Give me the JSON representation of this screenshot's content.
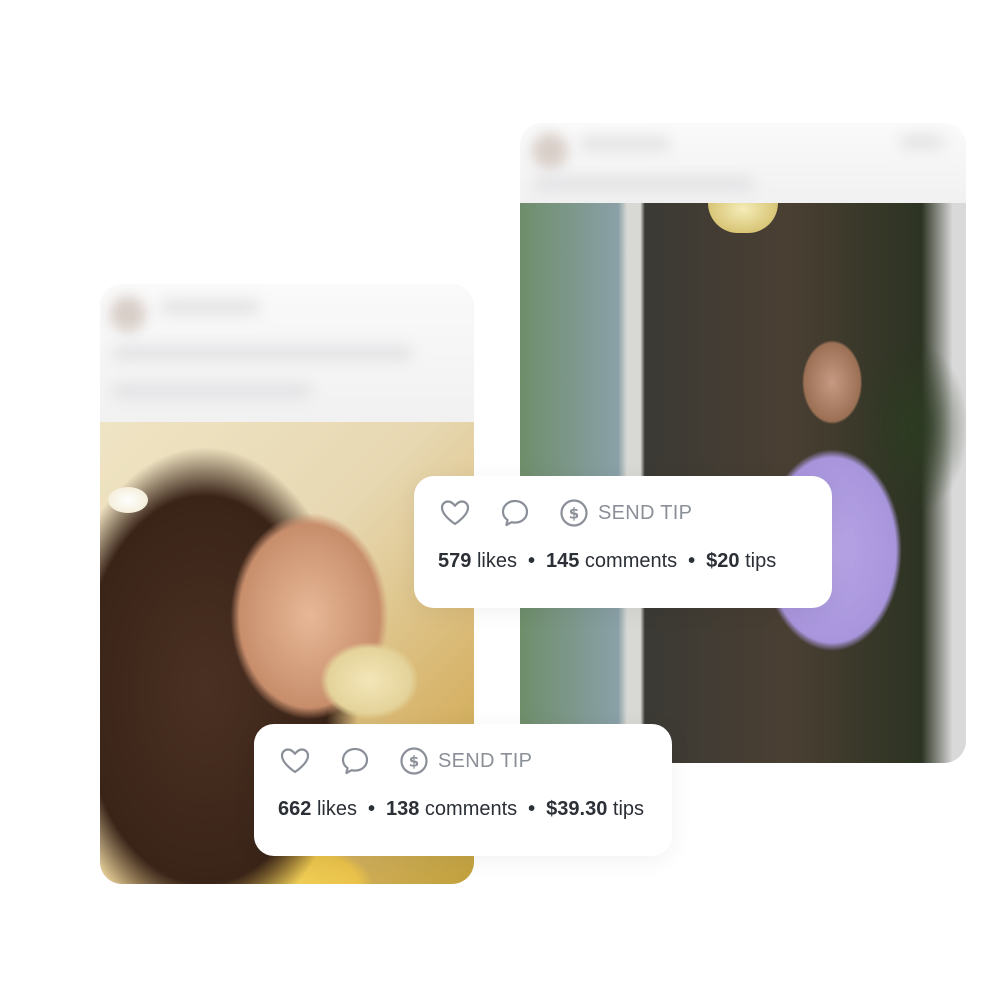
{
  "posts": [
    {
      "likes_count": "579",
      "likes_word": "likes",
      "comments_count": "145",
      "comments_word": "comments",
      "tips_amount": "$20",
      "tips_word": "tips",
      "tip_button_label": "SEND TIP",
      "separator": "•"
    },
    {
      "likes_count": "662",
      "likes_word": "likes",
      "comments_count": "138",
      "comments_word": "comments",
      "tips_amount": "$39.30",
      "tips_word": "tips",
      "tip_button_label": "SEND TIP",
      "separator": "•"
    }
  ],
  "icons": {
    "like": "heart-icon",
    "comment": "comment-bubble-icon",
    "tip": "dollar-circle-icon"
  },
  "colors": {
    "icon_gray": "#8a8f98",
    "text_dark": "#2b2f36",
    "panel_bg": "#ffffff"
  }
}
